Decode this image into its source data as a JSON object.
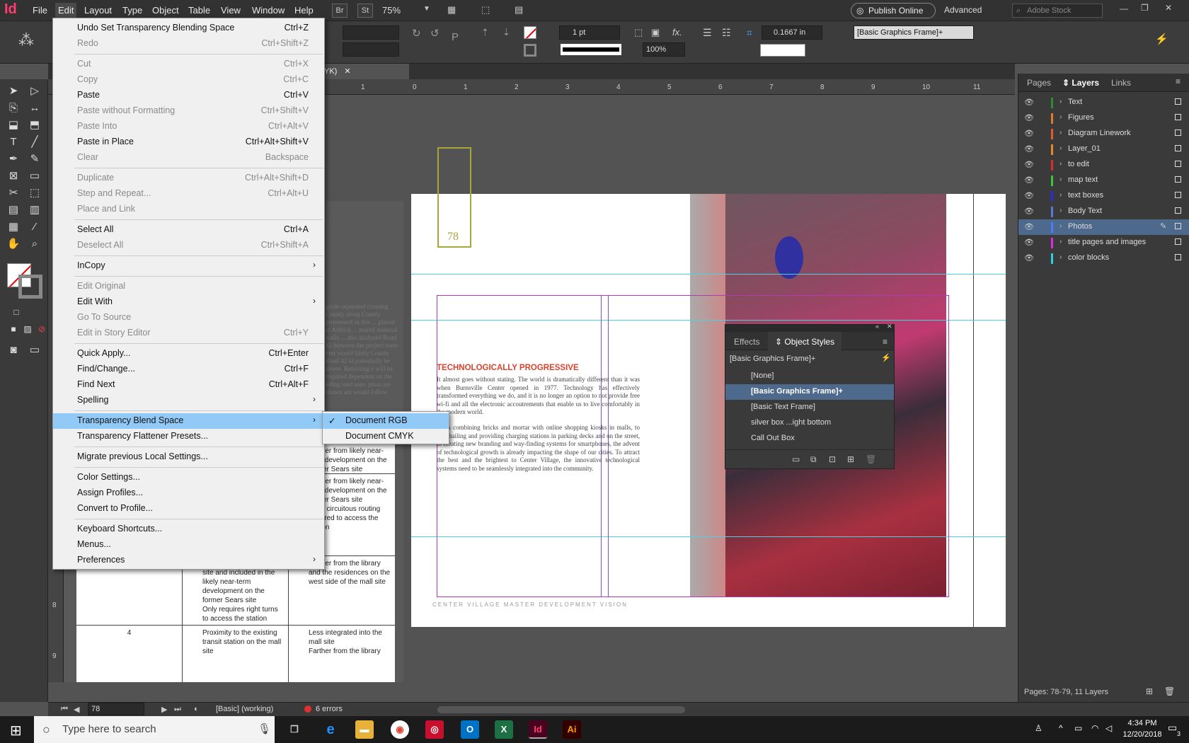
{
  "menubar": {
    "logo": "Id",
    "items": [
      "File",
      "Edit",
      "Layout",
      "Type",
      "Object",
      "Table",
      "View",
      "Window",
      "Help"
    ],
    "bridge": "Br",
    "stock": "St",
    "zoom": "75%",
    "publish": "Publish Online",
    "workspace": "Advanced",
    "search_placeholder": "Adobe Stock"
  },
  "control": {
    "stroke_weight": "1 pt",
    "opacity": "100%",
    "offset": "0.1667 in",
    "object_style": "[Basic Graphics Frame]+"
  },
  "doc_tab": {
    "label": "YK)"
  },
  "ruler": {
    "ticks": [
      "1",
      "0",
      "1",
      "2",
      "3",
      "4",
      "5",
      "6",
      "7",
      "8",
      "9",
      "10",
      "11"
    ],
    "v_ticks": [
      "8",
      "9"
    ]
  },
  "edit_menu": {
    "items": [
      {
        "label": "Undo Set Transparency Blending Space",
        "shortcut": "Ctrl+Z",
        "disabled": false
      },
      {
        "label": "Redo",
        "shortcut": "Ctrl+Shift+Z",
        "disabled": true
      },
      {
        "sep": true
      },
      {
        "label": "Cut",
        "shortcut": "Ctrl+X",
        "disabled": true
      },
      {
        "label": "Copy",
        "shortcut": "Ctrl+C",
        "disabled": true
      },
      {
        "label": "Paste",
        "shortcut": "Ctrl+V",
        "disabled": false
      },
      {
        "label": "Paste without Formatting",
        "shortcut": "Ctrl+Shift+V",
        "disabled": true
      },
      {
        "label": "Paste Into",
        "shortcut": "Ctrl+Alt+V",
        "disabled": true
      },
      {
        "label": "Paste in Place",
        "shortcut": "Ctrl+Alt+Shift+V",
        "disabled": false
      },
      {
        "label": "Clear",
        "shortcut": "Backspace",
        "disabled": true
      },
      {
        "sep": true
      },
      {
        "label": "Duplicate",
        "shortcut": "Ctrl+Alt+Shift+D",
        "disabled": true
      },
      {
        "label": "Step and Repeat...",
        "shortcut": "Ctrl+Alt+U",
        "disabled": true
      },
      {
        "label": "Place and Link",
        "shortcut": "",
        "disabled": true
      },
      {
        "sep": true
      },
      {
        "label": "Select All",
        "shortcut": "Ctrl+A",
        "disabled": false
      },
      {
        "label": "Deselect All",
        "shortcut": "Ctrl+Shift+A",
        "disabled": true
      },
      {
        "sep": true
      },
      {
        "label": "InCopy",
        "shortcut": "",
        "disabled": false,
        "sub": true
      },
      {
        "sep": true
      },
      {
        "label": "Edit Original",
        "shortcut": "",
        "disabled": true
      },
      {
        "label": "Edit With",
        "shortcut": "",
        "disabled": false,
        "sub": true
      },
      {
        "label": "Go To Source",
        "shortcut": "",
        "disabled": true
      },
      {
        "label": "Edit in Story Editor",
        "shortcut": "Ctrl+Y",
        "disabled": true
      },
      {
        "sep": true
      },
      {
        "label": "Quick Apply...",
        "shortcut": "Ctrl+Enter",
        "disabled": false
      },
      {
        "label": "Find/Change...",
        "shortcut": "Ctrl+F",
        "disabled": false
      },
      {
        "label": "Find Next",
        "shortcut": "Ctrl+Alt+F",
        "disabled": false
      },
      {
        "label": "Spelling",
        "shortcut": "",
        "disabled": false,
        "sub": true
      },
      {
        "sep": true
      },
      {
        "label": "Transparency Blend Space",
        "shortcut": "",
        "disabled": false,
        "sub": true,
        "highlight": true
      },
      {
        "label": "Transparency Flattener Presets...",
        "shortcut": "",
        "disabled": false
      },
      {
        "sep": true
      },
      {
        "label": "Migrate previous Local Settings...",
        "shortcut": "",
        "disabled": false
      },
      {
        "sep": true
      },
      {
        "label": "Color Settings...",
        "shortcut": "",
        "disabled": false
      },
      {
        "label": "Assign Profiles...",
        "shortcut": "",
        "disabled": false
      },
      {
        "label": "Convert to Profile...",
        "shortcut": "",
        "disabled": false
      },
      {
        "sep": true
      },
      {
        "label": "Keyboard Shortcuts...",
        "shortcut": "",
        "disabled": false
      },
      {
        "label": "Menus...",
        "shortcut": "",
        "disabled": false
      },
      {
        "label": "Preferences",
        "shortcut": "",
        "disabled": false,
        "sub": true
      }
    ]
  },
  "submenu": {
    "items": [
      {
        "label": "Document RGB",
        "checked": true
      },
      {
        "label": "Document CMYK",
        "checked": false
      }
    ]
  },
  "page": {
    "page_number": "78",
    "heading": "TECHNOLOGICALLY PROGRESSIVE",
    "para1": "It almost goes without stating. The world is dramatically different than it was when Burnsville Center opened in 1977. Technology has effectively transformed everything we do, and it is no longer an option to not provide free wi-fi and all the electronic accoutrements that enable us to live comfortably in the modern world.",
    "para2": "From combining bricks and mortar with online shopping kiosks in malls, to ride-hailing and providing charging stations in parking decks and on the street, to creating new branding and way-finding systems for smartphones, the advent of technological growth is already impacting the shape of our cities. To attract the best and the brightest to Center Village, the innovative technological systems need to be seamlessly integrated into the community.",
    "footer": "CENTER VILLAGE MASTER DEVELOPMENT VISION",
    "left_text": "grade separated crossing County along County provement in this ... placed at Aldrich ... mured material walls ... also analyzed Road 42 between the project team vert would likely County Road 42 ld potentially be above. Returning e will be required dependent on the nding land uses. ption are shown ant would follow"
  },
  "table": {
    "rows": [
      {
        "num": "",
        "c1": "",
        "c2": "mall site\nFarther from likely near-term development on the former Sears site"
      },
      {
        "num": "",
        "c1": "site",
        "c2": "Farther from likely near-term development on the former Sears site\nMore circuitous routing required to access the station"
      },
      {
        "num": "3",
        "c1": "Integrated into the mall site and included in the likely near-term development on the former Sears site\nOnly requires right turns to access the station",
        "c2": "Farther from the library and the residences on the west side of the mall site"
      },
      {
        "num": "4",
        "c1": "Proximity to the existing transit station on the mall site",
        "c2": "Less integrated into the mall site\nFarther from the library"
      }
    ]
  },
  "layers_panel": {
    "tabs": [
      "Pages",
      "Layers",
      "Links"
    ],
    "layers": [
      {
        "name": "Text",
        "color": "#2e8b2e",
        "selected": false
      },
      {
        "name": "Figures",
        "color": "#e07b2a",
        "selected": false
      },
      {
        "name": "Diagram Linework",
        "color": "#e05a2a",
        "selected": false
      },
      {
        "name": "Layer_01",
        "color": "#e08a2a",
        "selected": false
      },
      {
        "name": "to edit",
        "color": "#e02a2a",
        "selected": false
      },
      {
        "name": "map text",
        "color": "#3ac43a",
        "selected": false
      },
      {
        "name": "text boxes",
        "color": "#2a2ae0",
        "selected": false
      },
      {
        "name": "Body Text",
        "color": "#5a7ad8",
        "selected": false
      },
      {
        "name": "Photos",
        "color": "#4d7aff",
        "selected": true
      },
      {
        "name": "title pages and images",
        "color": "#e02ae0",
        "selected": false
      },
      {
        "name": "color blocks",
        "color": "#2ad0e0",
        "selected": false
      }
    ],
    "footer": "Pages: 78-79, 11 Layers"
  },
  "object_styles": {
    "tabs": [
      "Effects",
      "Object Styles"
    ],
    "current": "[Basic Graphics Frame]+",
    "items": [
      {
        "name": "[None]",
        "selected": false
      },
      {
        "name": "[Basic Graphics Frame]+",
        "selected": true
      },
      {
        "name": "[Basic Text Frame]",
        "selected": false
      },
      {
        "name": "silver box ...ight bottom",
        "selected": false
      },
      {
        "name": "Call Out Box",
        "selected": false
      }
    ]
  },
  "status": {
    "page": "78",
    "preflight_profile": "[Basic] (working)",
    "errors": "6 errors"
  },
  "taskbar": {
    "search": "Type here to search",
    "time": "4:34 PM",
    "date": "12/20/2018",
    "notif": "3"
  },
  "colors": {
    "accent": "#ff3d6f",
    "highlight": "#91c9f7",
    "heading": "#d8432e"
  }
}
